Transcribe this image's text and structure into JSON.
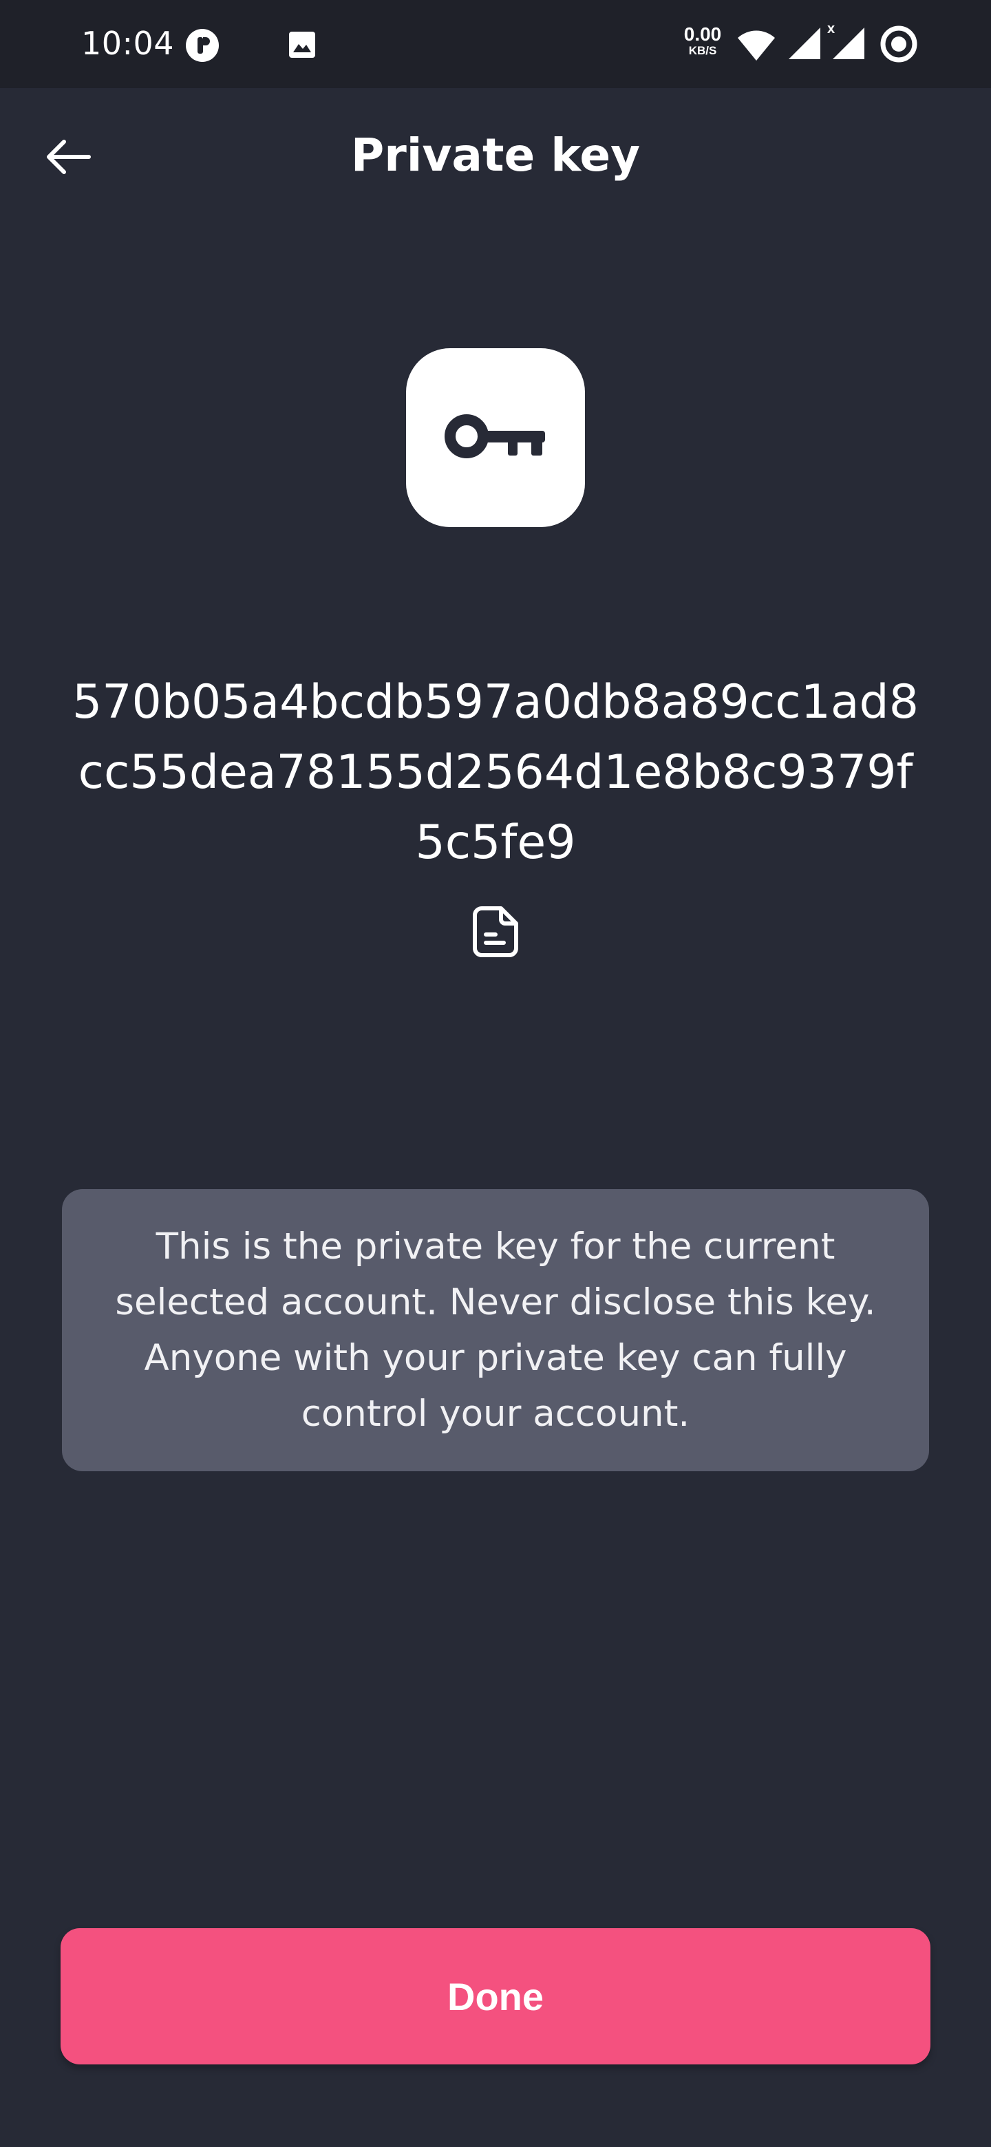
{
  "status_bar": {
    "time": "10:04",
    "net_speed_value": "0.00",
    "net_speed_unit": "KB/S",
    "icons": [
      "app-notification-icon",
      "image-icon",
      "wifi-icon",
      "signal-icon",
      "signal-no-data-icon",
      "focus-mode-icon"
    ]
  },
  "header": {
    "title": "Private key",
    "back_icon": "arrow-left-icon"
  },
  "key_tile": {
    "icon": "key-icon"
  },
  "private_key": {
    "value": "570b05a4bcdb597a0db8a89cc1ad8cc55dea78155d2564d1e8b8c9379f5c5fe9",
    "copy_icon": "copy-document-icon"
  },
  "warning": {
    "text": "This is the private key for the current selected account. Never disclose this key. Anyone with your private key can fully control your account."
  },
  "actions": {
    "done_label": "Done"
  },
  "colors": {
    "background": "#272a36",
    "status_bar": "#1f2129",
    "card": "#585b6b",
    "accent": "#f4517f",
    "text": "#ffffff"
  }
}
